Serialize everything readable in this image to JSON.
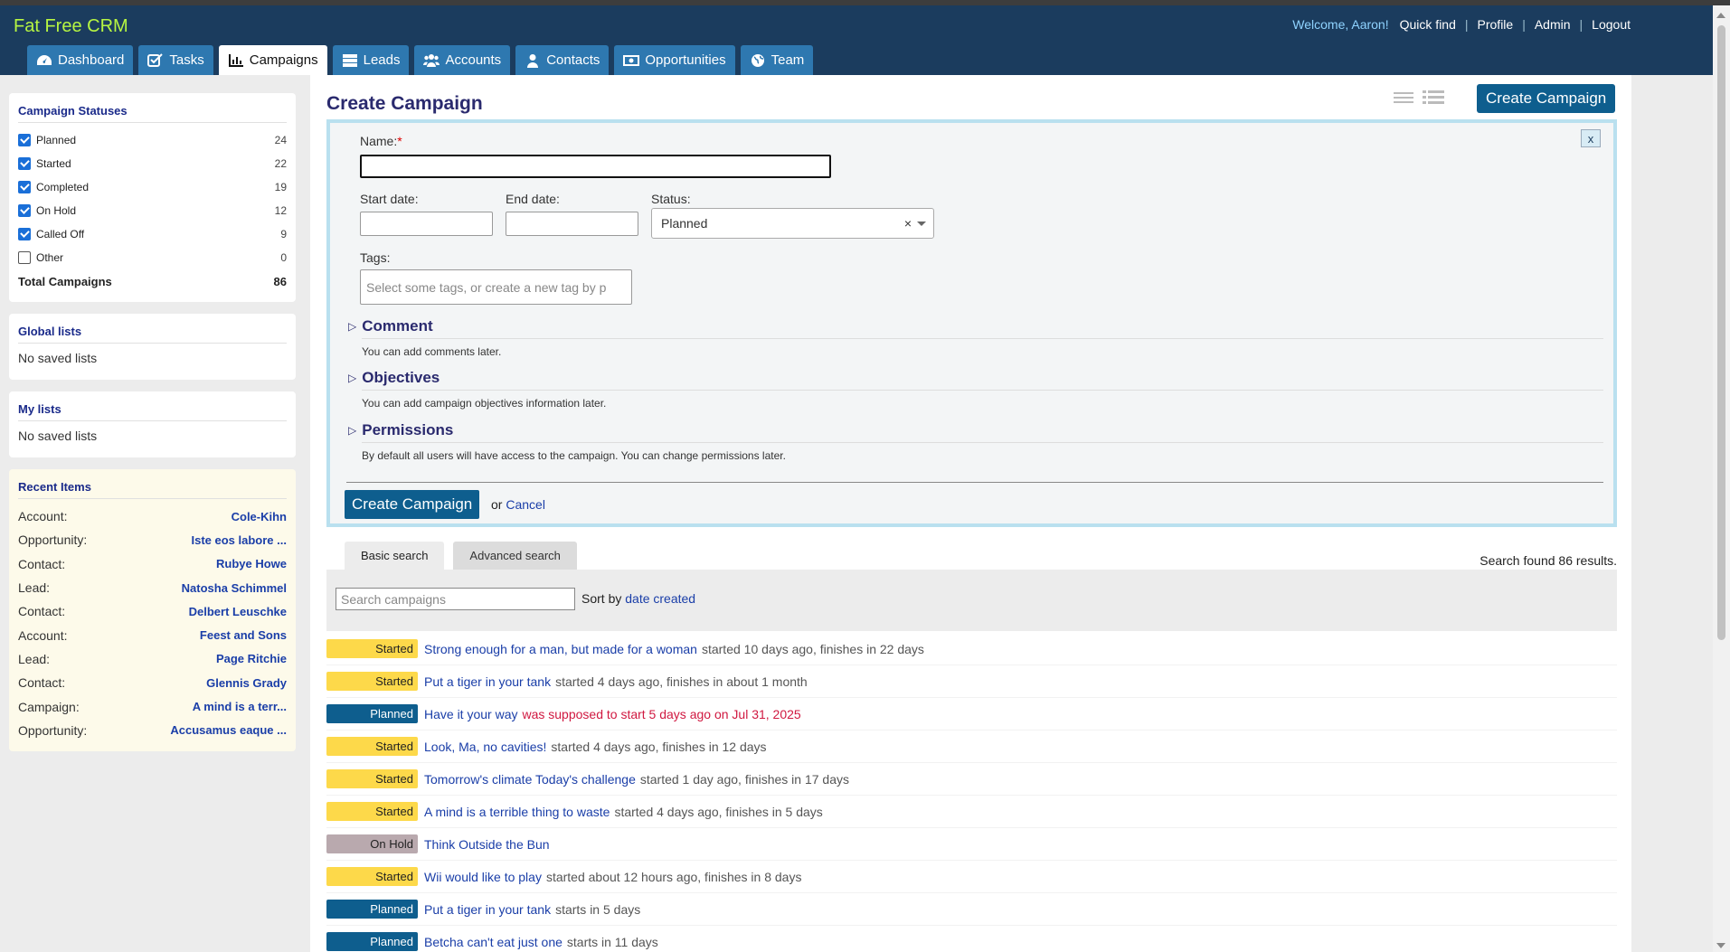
{
  "app": {
    "logo": "Fat Free CRM"
  },
  "toplinks": {
    "welcome": "Welcome, Aaron!",
    "quickfind": "Quick find",
    "profile": "Profile",
    "admin": "Admin",
    "logout": "Logout"
  },
  "tabs": [
    {
      "label": "Dashboard",
      "icon": "dashboard-icon"
    },
    {
      "label": "Tasks",
      "icon": "checkbox-icon"
    },
    {
      "label": "Campaigns",
      "icon": "bar-chart-icon",
      "active": true
    },
    {
      "label": "Leads",
      "icon": "server-icon"
    },
    {
      "label": "Accounts",
      "icon": "users-icon"
    },
    {
      "label": "Contacts",
      "icon": "user-icon"
    },
    {
      "label": "Opportunities",
      "icon": "money-icon"
    },
    {
      "label": "Team",
      "icon": "globe-icon"
    }
  ],
  "sidebar": {
    "statuses": {
      "title": "Campaign Statuses",
      "items": [
        {
          "label": "Planned",
          "count": "24",
          "checked": true
        },
        {
          "label": "Started",
          "count": "22",
          "checked": true
        },
        {
          "label": "Completed",
          "count": "19",
          "checked": true
        },
        {
          "label": "On Hold",
          "count": "12",
          "checked": true
        },
        {
          "label": "Called Off",
          "count": "9",
          "checked": true
        },
        {
          "label": "Other",
          "count": "0",
          "checked": false
        }
      ],
      "total_label": "Total Campaigns",
      "total_value": "86"
    },
    "global_lists": {
      "title": "Global lists",
      "empty": "No saved lists"
    },
    "my_lists": {
      "title": "My lists",
      "empty": "No saved lists"
    },
    "recent": {
      "title": "Recent Items",
      "items": [
        {
          "type": "Account:",
          "name": "Cole-Kihn"
        },
        {
          "type": "Opportunity:",
          "name": "Iste eos labore ..."
        },
        {
          "type": "Contact:",
          "name": "Rubye Howe"
        },
        {
          "type": "Lead:",
          "name": "Natosha Schimmel"
        },
        {
          "type": "Contact:",
          "name": "Delbert Leuschke"
        },
        {
          "type": "Account:",
          "name": "Feest and Sons"
        },
        {
          "type": "Lead:",
          "name": "Page Ritchie"
        },
        {
          "type": "Contact:",
          "name": "Glennis Grady"
        },
        {
          "type": "Campaign:",
          "name": "A mind is a terr..."
        },
        {
          "type": "Opportunity:",
          "name": "Accusamus eaque ..."
        }
      ]
    }
  },
  "main": {
    "title": "Create Campaign",
    "create_button": "Create Campaign",
    "form": {
      "close": "x",
      "name_label": "Name:",
      "required_mark": "*",
      "name_value": "",
      "start_label": "Start date:",
      "end_label": "End date:",
      "status_label": "Status:",
      "status_value": "Planned",
      "status_clear": "×",
      "tags_label": "Tags:",
      "tags_placeholder": "Select some tags, or create a new tag by p",
      "sections": [
        {
          "title": "Comment",
          "note": "You can add comments later."
        },
        {
          "title": "Objectives",
          "note": "You can add campaign objectives information later."
        },
        {
          "title": "Permissions",
          "note": "By default all users will have access to the campaign. You can change permissions later."
        }
      ],
      "submit": "Create Campaign",
      "or": "or",
      "cancel": "Cancel"
    },
    "search": {
      "tab_basic": "Basic search",
      "tab_advanced": "Advanced search",
      "found": "Search found 86 results.",
      "placeholder": "Search campaigns",
      "sort_label": "Sort by",
      "sort_value": "date created"
    },
    "campaigns": [
      {
        "status": "Started",
        "kind": "started",
        "name": "Strong enough for a man, but made for a woman",
        "desc": "started 10 days ago, finishes in 22 days"
      },
      {
        "status": "Started",
        "kind": "started",
        "name": "Put a tiger in your tank",
        "desc": "started 4 days ago, finishes in about 1 month"
      },
      {
        "status": "Planned",
        "kind": "planned",
        "name": "Have it your way",
        "desc": "was supposed to start 5 days ago on Jul 31, 2025",
        "late": true
      },
      {
        "status": "Started",
        "kind": "started",
        "name": "Look, Ma, no cavities!",
        "desc": "started 4 days ago, finishes in 12 days"
      },
      {
        "status": "Started",
        "kind": "started",
        "name": "Tomorrow's climate Today's challenge",
        "desc": "started 1 day ago, finishes in 17 days"
      },
      {
        "status": "Started",
        "kind": "started",
        "name": "A mind is a terrible thing to waste",
        "desc": "started 4 days ago, finishes in 5 days"
      },
      {
        "status": "On Hold",
        "kind": "onhold",
        "name": "Think Outside the Bun",
        "desc": ""
      },
      {
        "status": "Started",
        "kind": "started",
        "name": "Wii would like to play",
        "desc": "started about 12 hours ago, finishes in 8 days"
      },
      {
        "status": "Planned",
        "kind": "planned",
        "name": "Put a tiger in your tank",
        "desc": "starts in 5 days"
      },
      {
        "status": "Planned",
        "kind": "planned",
        "name": "Betcha can't eat just one",
        "desc": "starts in 11 days"
      }
    ]
  }
}
